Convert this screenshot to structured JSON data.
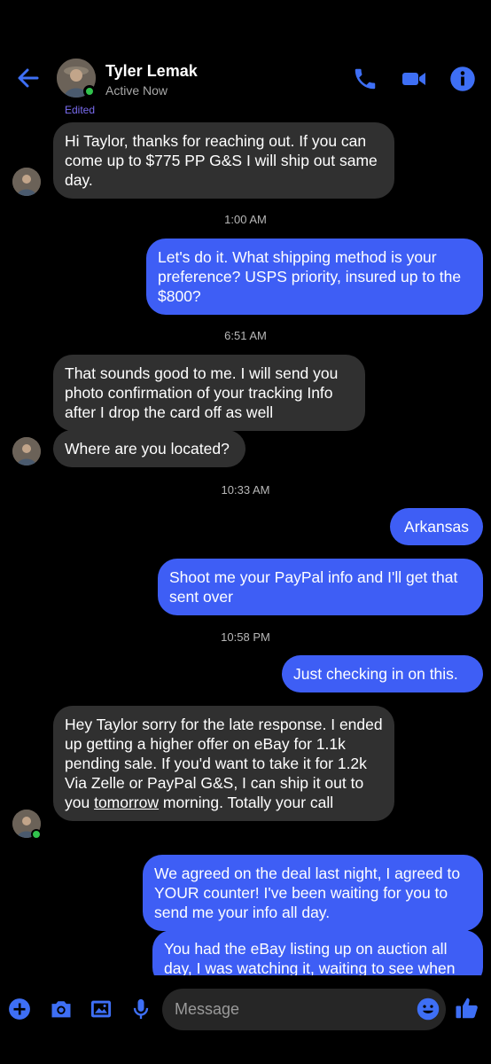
{
  "header": {
    "contact_name": "Tyler Lemak",
    "status": "Active Now",
    "edited_label": "Edited"
  },
  "messages": [
    {
      "from": "them",
      "text": "Hi Taylor, thanks for reaching out. If you can come up to $775 PP G&S I will ship out same day."
    },
    {
      "time": "1:00 AM"
    },
    {
      "from": "me",
      "text": "Let's do it. What shipping method is your preference? USPS priority, insured up to the $800?"
    },
    {
      "time": "6:51 AM"
    },
    {
      "from": "them",
      "text": "That sounds good to me. I will send you photo confirmation of your tracking Info after I drop the card off as well"
    },
    {
      "from": "them",
      "text": "Where are you located?"
    },
    {
      "time": "10:33 AM"
    },
    {
      "from": "me",
      "text": "Arkansas"
    },
    {
      "from": "me",
      "text": "Shoot me your PayPal info and I'll get that sent over"
    },
    {
      "time": "10:58 PM"
    },
    {
      "from": "me",
      "text": "Just checking in on this."
    },
    {
      "from": "them",
      "text_before": "Hey Taylor sorry for the late response. I ended up getting a higher offer on eBay for 1.1k pending sale. If you'd want to take it for 1.2k Via Zelle or PayPal G&S, I can ship it out to you ",
      "text_underlined": "tomorrow",
      "text_after": " morning. Totally your call"
    },
    {
      "from": "me",
      "text": "We agreed on the deal last night, I agreed to YOUR counter! I've been waiting for you to send me your info all day."
    },
    {
      "from": "me",
      "text": "You had the eBay listing up on auction all day, I was watching it, waiting to see when"
    }
  ],
  "composer": {
    "placeholder": "Message"
  },
  "icons": {
    "back": "arrow-left-icon",
    "call": "phone-icon",
    "video": "video-camera-icon",
    "info": "info-icon",
    "more": "plus-icon",
    "camera": "camera-icon",
    "gallery": "image-icon",
    "voice": "microphone-icon",
    "emoji": "smiley-icon",
    "like": "thumbs-up-icon"
  },
  "colors": {
    "accent": "#3e5ef5",
    "incoming_bubble": "#303030",
    "background": "#000000",
    "online": "#31c24d"
  }
}
